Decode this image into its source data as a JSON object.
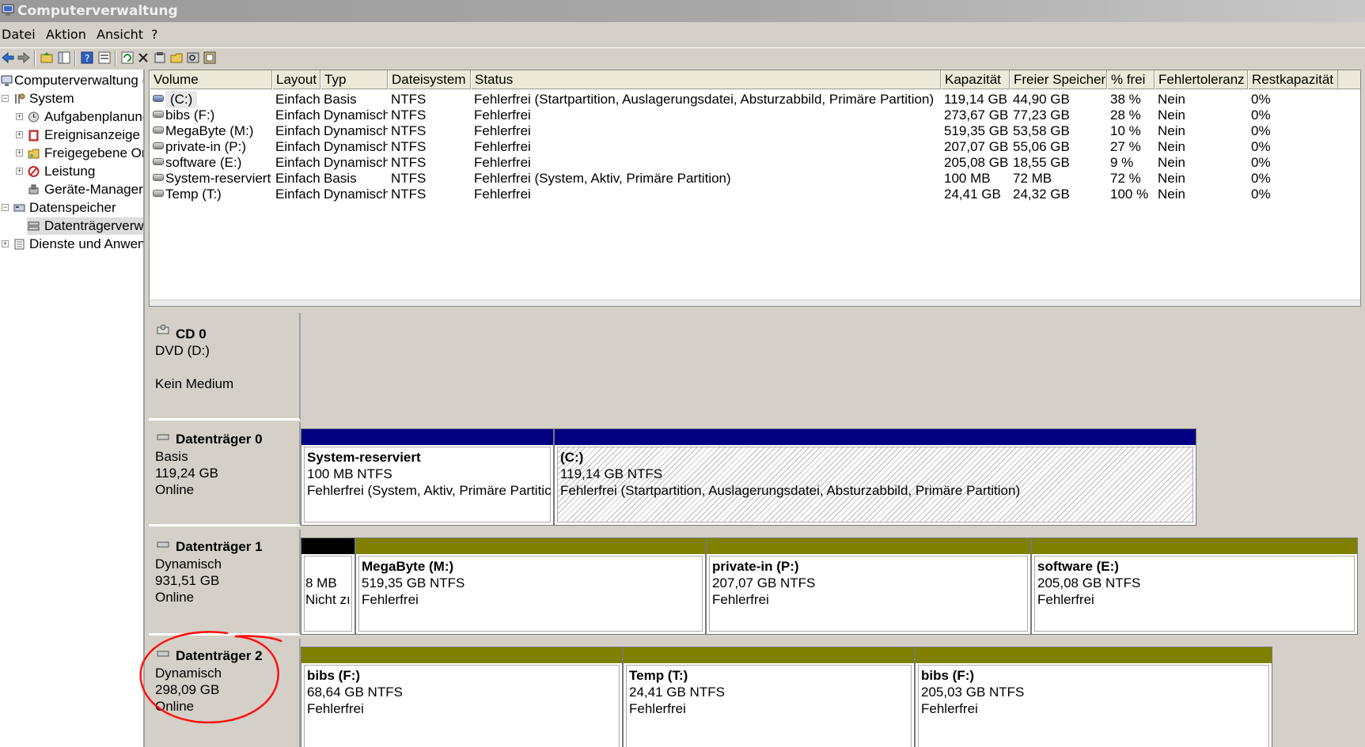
{
  "window": {
    "title": "Computerverwaltung",
    "app_icon": "computer-management-icon"
  },
  "menu": [
    "Datei",
    "Aktion",
    "Ansicht",
    "?"
  ],
  "toolbar_icons": [
    "back-icon",
    "forward-icon",
    "up-folder-icon",
    "show-hide-tree-icon",
    "help-icon",
    "properties-view-icon",
    "refresh-icon",
    "delete-icon",
    "properties-icon",
    "open-icon",
    "search-icon",
    "settings-icon"
  ],
  "tree": [
    {
      "label": "Computerverwaltung (",
      "icon": "computer-management-icon"
    },
    {
      "label": "System",
      "icon": "tools-icon"
    },
    {
      "label": "Aufgabenplanung",
      "icon": "clock-icon"
    },
    {
      "label": "Ereignisanzeige",
      "icon": "event-viewer-icon"
    },
    {
      "label": "Freigegebene Ord",
      "icon": "shared-folder-icon"
    },
    {
      "label": "Leistung",
      "icon": "performance-icon"
    },
    {
      "label": "Geräte-Manager",
      "icon": "device-manager-icon"
    },
    {
      "label": "Datenspeicher",
      "icon": "storage-icon"
    },
    {
      "label": "Datenträgerverw",
      "icon": "disk-management-icon"
    },
    {
      "label": "Dienste und Anwen",
      "icon": "services-icon"
    }
  ],
  "columns": [
    "Volume",
    "Layout",
    "Typ",
    "Dateisystem",
    "Status",
    "Kapazität",
    "Freier Speicher",
    "% frei",
    "Fehlertoleranz",
    "Restkapazität"
  ],
  "volumes": [
    [
      "(C:)",
      "Einfach",
      "Basis",
      "NTFS",
      "Fehlerfrei (Startpartition, Auslagerungsdatei, Absturzabbild, Primäre Partition)",
      "119,14 GB",
      "44,90 GB",
      "38 %",
      "Nein",
      "0%"
    ],
    [
      "bibs (F:)",
      "Einfach",
      "Dynamisch",
      "NTFS",
      "Fehlerfrei",
      "273,67 GB",
      "77,23 GB",
      "28 %",
      "Nein",
      "0%"
    ],
    [
      "MegaByte (M:)",
      "Einfach",
      "Dynamisch",
      "NTFS",
      "Fehlerfrei",
      "519,35 GB",
      "53,58 GB",
      "10 %",
      "Nein",
      "0%"
    ],
    [
      "private-in (P:)",
      "Einfach",
      "Dynamisch",
      "NTFS",
      "Fehlerfrei",
      "207,07 GB",
      "55,06 GB",
      "27 %",
      "Nein",
      "0%"
    ],
    [
      "software (E:)",
      "Einfach",
      "Dynamisch",
      "NTFS",
      "Fehlerfrei",
      "205,08 GB",
      "18,55 GB",
      "9 %",
      "Nein",
      "0%"
    ],
    [
      "System-reserviert",
      "Einfach",
      "Basis",
      "NTFS",
      "Fehlerfrei (System, Aktiv, Primäre Partition)",
      "100 MB",
      "72 MB",
      "72 %",
      "Nein",
      "0%"
    ],
    [
      "Temp (T:)",
      "Einfach",
      "Dynamisch",
      "NTFS",
      "Fehlerfrei",
      "24,41 GB",
      "24,32 GB",
      "100 %",
      "Nein",
      "0%"
    ]
  ],
  "disks": {
    "cd0": {
      "name": "CD 0",
      "type": "DVD (D:)",
      "state": "Kein Medium"
    },
    "d0": {
      "name": "Datenträger 0",
      "type": "Basis",
      "size": "119,24 GB",
      "state": "Online",
      "parts": [
        {
          "name": "System-reserviert",
          "size": "100 MB NTFS",
          "status": "Fehlerfrei (System, Aktiv, Primäre Partitic"
        },
        {
          "name": " (C:)",
          "size": "119,14 GB NTFS",
          "status": "Fehlerfrei (Startpartition, Auslagerungsdatei, Absturzabbild, Primäre Partition)"
        }
      ]
    },
    "d1": {
      "name": "Datenträger 1",
      "type": "Dynamisch",
      "size": "931,51 GB",
      "state": "Online",
      "parts": [
        {
          "name": "",
          "size": "8 MB",
          "status": "Nicht zı"
        },
        {
          "name": "MegaByte  (M:)",
          "size": "519,35 GB NTFS",
          "status": "Fehlerfrei"
        },
        {
          "name": "private-in  (P:)",
          "size": "207,07 GB NTFS",
          "status": "Fehlerfrei"
        },
        {
          "name": "software  (E:)",
          "size": "205,08 GB NTFS",
          "status": "Fehlerfrei"
        }
      ]
    },
    "d2": {
      "name": "Datenträger 2",
      "type": "Dynamisch",
      "size": "298,09 GB",
      "state": "Online",
      "parts": [
        {
          "name": "bibs  (F:)",
          "size": "68,64 GB NTFS",
          "status": "Fehlerfrei"
        },
        {
          "name": "Temp  (T:)",
          "size": "24,41 GB NTFS",
          "status": "Fehlerfrei"
        },
        {
          "name": "bibs  (F:)",
          "size": "205,03 GB NTFS",
          "status": "Fehlerfrei"
        }
      ]
    }
  },
  "colors": {
    "basic_partition": "#000080",
    "simple_volume": "#808000",
    "unallocated": "#000000",
    "annotation": "#ff0000"
  }
}
